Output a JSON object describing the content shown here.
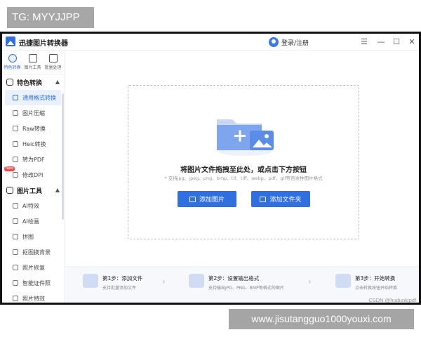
{
  "overlay": {
    "tag": "TG: MYYJJPP",
    "watermark": "www.jisutangguo1000youxi.com"
  },
  "app": {
    "title": "迅捷图片转换器",
    "user_label": "登录/注册",
    "window_buttons": [
      "☰",
      "—",
      "☐",
      "✕"
    ]
  },
  "sidebar": {
    "top_tabs": [
      {
        "label": "特色转换",
        "icon": "convert-icon"
      },
      {
        "label": "图片工具",
        "icon": "image-tools-icon"
      },
      {
        "label": "批量处理",
        "icon": "batch-icon"
      }
    ],
    "sections": [
      {
        "title": "特色转换",
        "chevron": "▲",
        "items": [
          "通用格式转换",
          "图片压缩",
          "Raw转换",
          "Heic转换",
          "转为PDF",
          "修改DPI"
        ]
      },
      {
        "title": "图片工具",
        "chevron": "▲",
        "items": [
          "AI特效",
          "AI绘画",
          "拼图",
          "抠图换背景",
          "照片修复",
          "智能证件照",
          "照片特效"
        ]
      }
    ],
    "badge": "New"
  },
  "main": {
    "drop_title": "将图片文件拖拽至此处，或点击下方按钮",
    "drop_subtitle": "* 支持jpg、jpeg、png、bmp、tif、tiff、webp、pdf、gif等百余种图片格式",
    "add_image": "添加图片",
    "add_folder": "添加文件夹"
  },
  "steps": [
    {
      "title": "第1步：添加文件",
      "desc": "支持批量添加文件"
    },
    {
      "title": "第2步：设置输出格式",
      "desc": "支持输出JPG、PNG、BMP等格式的图片"
    },
    {
      "title": "第3步：开始转换",
      "desc": "点击转换按钮开始转换"
    }
  ],
  "csdn": "CSDN @hudunkjpdf",
  "colors": {
    "accent": "#2f6fe0",
    "badge": "#f04a4a"
  }
}
